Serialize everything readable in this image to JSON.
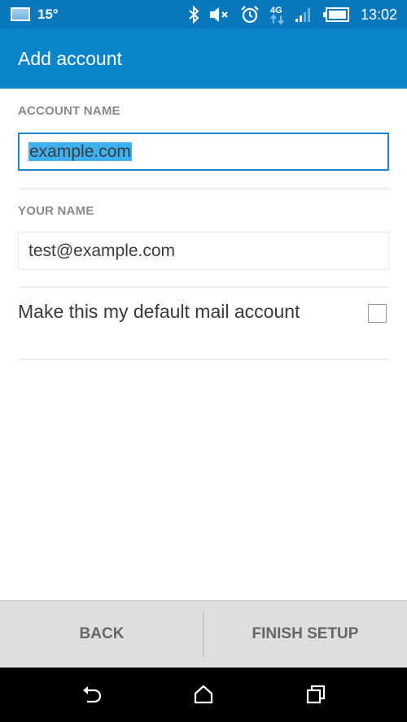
{
  "status_bar": {
    "temperature": "15°",
    "time": "13:02",
    "network_type": "4G",
    "icons": [
      "weather-icon",
      "bluetooth-icon",
      "volume-muted-icon",
      "alarm-icon",
      "network-4g-icon",
      "signal-icon",
      "battery-icon"
    ]
  },
  "app_bar": {
    "title": "Add account"
  },
  "form": {
    "account_name": {
      "label": "ACCOUNT NAME",
      "value": "example.com",
      "focused": true,
      "selected": true
    },
    "your_name": {
      "label": "YOUR NAME",
      "value": "test@example.com"
    },
    "default_account": {
      "label": "Make this my default mail account",
      "checked": false
    }
  },
  "buttons": {
    "back": "BACK",
    "finish": "FINISH SETUP"
  },
  "nav_bar": {
    "icons": [
      "back-icon",
      "home-icon",
      "recent-apps-icon"
    ]
  },
  "colors": {
    "status_bar": "#0a78bd",
    "app_bar": "#0a85cc",
    "focus": "#1b87cf",
    "selection": "#3db0f0"
  }
}
